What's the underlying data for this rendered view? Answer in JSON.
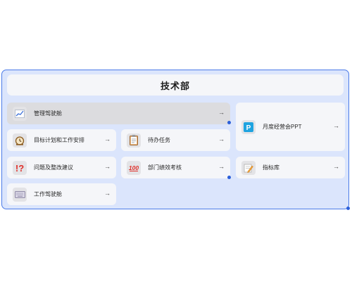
{
  "department": {
    "title": "技术部"
  },
  "cards": {
    "mgmt_cockpit": {
      "label": "管理驾驶舱",
      "icon": "line-chart-icon"
    },
    "monthly_ppt": {
      "label": "月度经营会PPT",
      "icon": "powerpoint-icon"
    },
    "goal_plan": {
      "label": "目标计划和工作安排",
      "icon": "alarm-clock-icon"
    },
    "todo": {
      "label": "待办任务",
      "icon": "clipboard-icon"
    },
    "issues": {
      "label": "问题及整改建议",
      "icon": "exclamation-question-icon"
    },
    "performance": {
      "label": "部门绩效考核",
      "icon": "hundred-points-icon"
    },
    "metrics": {
      "label": "指标库",
      "icon": "pencil-note-icon"
    },
    "work_cockpit": {
      "label": "工作驾驶舱",
      "icon": "keyboard-icon"
    }
  },
  "arrow": "→",
  "colors": {
    "panel_bg": "#dbe5fc",
    "panel_border": "#4b7be8",
    "card_bg": "#f5f6f9",
    "selected_bg": "#dcdcdf",
    "accent": "#2b5fd9"
  }
}
